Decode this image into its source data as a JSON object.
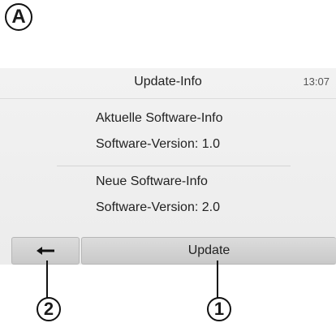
{
  "figure_label": "A",
  "header": {
    "title": "Update-Info",
    "clock": "13:07"
  },
  "current": {
    "heading": "Aktuelle Software-Info",
    "version": "Software-Version: 1.0"
  },
  "new": {
    "heading": "Neue Software-Info",
    "version": "Software-Version: 2.0"
  },
  "footer": {
    "update_label": "Update"
  },
  "callouts": {
    "back": "2",
    "update": "1"
  },
  "icons": {
    "back": "left-arrow"
  }
}
